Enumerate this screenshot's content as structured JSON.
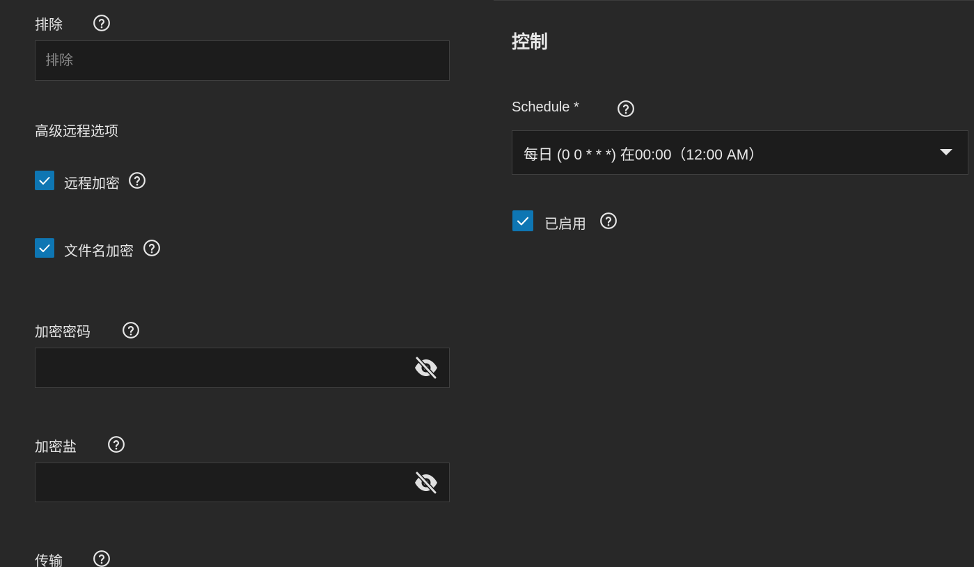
{
  "left": {
    "exclude": {
      "label": "排除",
      "placeholder": "排除"
    },
    "advanced_remote_options": {
      "label": "高级远程选项"
    },
    "remote_encryption": {
      "label": "远程加密",
      "checked": true
    },
    "filename_encryption": {
      "label": "文件名加密",
      "checked": true
    },
    "encryption_password": {
      "label": "加密密码",
      "value": ""
    },
    "encryption_salt": {
      "label": "加密盐",
      "value": ""
    },
    "transfer": {
      "label": "传输"
    }
  },
  "right": {
    "section_title": "控制",
    "schedule": {
      "label": "Schedule *",
      "value": "每日 (0 0 * * *) 在00:00（12:00 AM）"
    },
    "enabled": {
      "label": "已启用",
      "checked": true
    }
  },
  "colors": {
    "background": "#282828",
    "field_background": "#1c1c1c",
    "checkbox_accent": "#0e76b3"
  },
  "icons": {
    "help": "help-circle-icon",
    "eye": "eye-off-icon",
    "check": "check-icon",
    "dropdown": "caret-down-icon"
  }
}
